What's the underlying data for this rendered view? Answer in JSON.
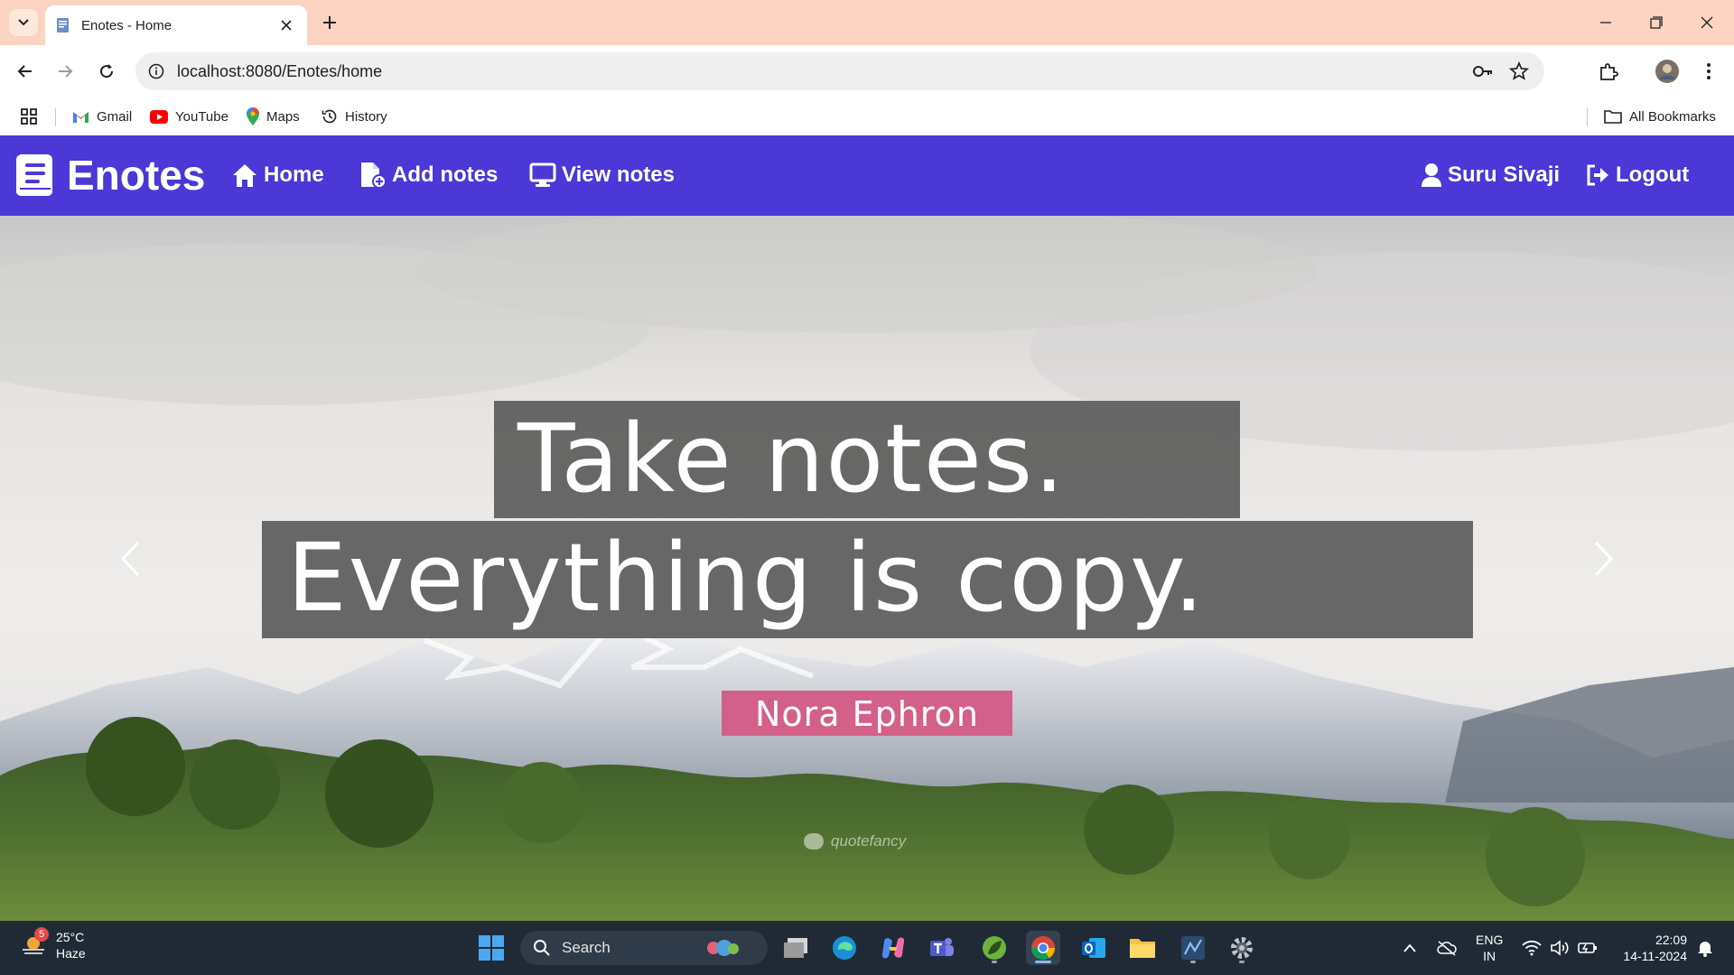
{
  "browser": {
    "tab_title": "Enotes - Home",
    "url": "localhost:8080/Enotes/home",
    "bookmarks": [
      "Gmail",
      "YouTube",
      "Maps",
      "History"
    ],
    "all_bookmarks": "All Bookmarks"
  },
  "navbar": {
    "brand": "Enotes",
    "links": [
      "Home",
      "Add notes",
      "View notes"
    ],
    "user": "Suru Sivaji",
    "logout": "Logout",
    "color": "#4b38d6"
  },
  "hero": {
    "line1": "Take notes.",
    "line2": "Everything is copy.",
    "author": "Nora Ephron",
    "watermark": "quotefancy",
    "author_color": "#d36088"
  },
  "taskbar": {
    "weather_temp": "25°C",
    "weather_desc": "Haze",
    "weather_badge": "5",
    "search": "Search",
    "lang_line1": "ENG",
    "lang_line2": "IN",
    "time": "22:09",
    "date": "14-11-2024"
  }
}
